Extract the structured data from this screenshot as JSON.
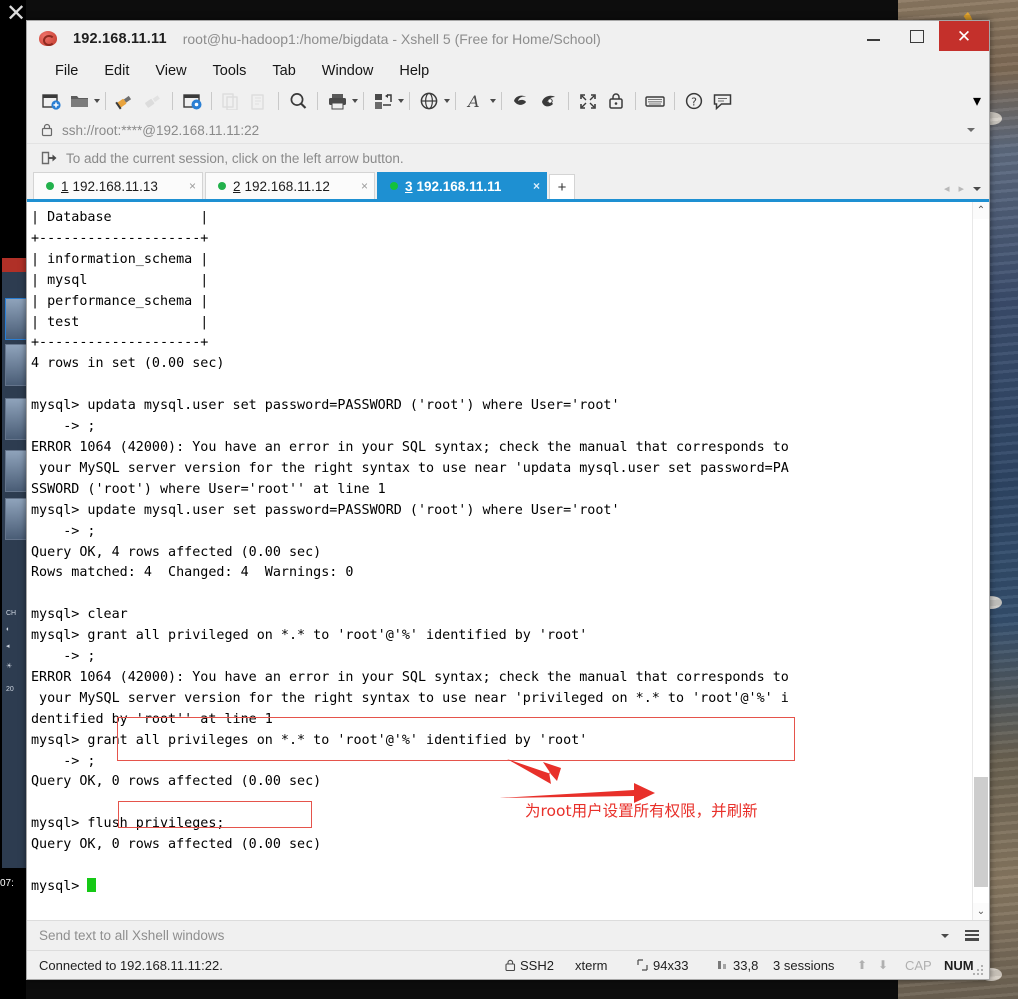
{
  "window": {
    "title_ip": "192.168.11.11",
    "title_rest": "root@hu-hadoop1:/home/bigdata - Xshell 5 (Free for Home/School)",
    "app_icon": "xshell-logo-icon",
    "minimize_label": "–",
    "maximize_label": "□",
    "close_label": "✕"
  },
  "menu": {
    "items": [
      {
        "label": "File"
      },
      {
        "label": "Edit"
      },
      {
        "label": "View"
      },
      {
        "label": "Tools"
      },
      {
        "label": "Tab"
      },
      {
        "label": "Window"
      },
      {
        "label": "Help"
      }
    ]
  },
  "toolbar": {
    "icons": [
      {
        "name": "new-session-icon"
      },
      {
        "name": "open-folder-icon"
      },
      {
        "name": "connect-plug-icon"
      },
      {
        "name": "disconnect-plug-icon"
      },
      {
        "name": "session-properties-icon"
      },
      {
        "name": "copy-icon"
      },
      {
        "name": "paste-icon"
      },
      {
        "name": "find-icon"
      },
      {
        "name": "print-icon"
      },
      {
        "name": "transfer-icon"
      },
      {
        "name": "globe-icon"
      },
      {
        "name": "font-icon"
      },
      {
        "name": "xftp-icon"
      },
      {
        "name": "xagent-icon"
      },
      {
        "name": "fullscreen-icon"
      },
      {
        "name": "lock-icon"
      },
      {
        "name": "keyboard-icon"
      },
      {
        "name": "help-icon"
      },
      {
        "name": "feedback-icon"
      }
    ],
    "overflow_label": "▾"
  },
  "address_bar": {
    "lock_icon": "lock-icon",
    "url": "ssh://root:****@192.168.11.11:22"
  },
  "hint_bar": {
    "icon": "add-session-icon",
    "text": "To add the current session, click on the left arrow button."
  },
  "tabs": {
    "items": [
      {
        "num": "1",
        "label": "192.168.11.13",
        "active": false,
        "close": "×"
      },
      {
        "num": "2",
        "label": "192.168.11.12",
        "active": false,
        "close": "×"
      },
      {
        "num": "3",
        "label": "192.168.11.11",
        "active": true,
        "close": "×"
      }
    ],
    "new_tab_label": "+",
    "nav_prev": "◂",
    "nav_next": "▸"
  },
  "terminal": {
    "lines": [
      "| Database           |",
      "+--------------------+",
      "| information_schema |",
      "| mysql              |",
      "| performance_schema |",
      "| test               |",
      "+--------------------+",
      "4 rows in set (0.00 sec)",
      "",
      "mysql> updata mysql.user set password=PASSWORD ('root') where User='root'",
      "    -> ;",
      "ERROR 1064 (42000): You have an error in your SQL syntax; check the manual that corresponds to",
      " your MySQL server version for the right syntax to use near 'updata mysql.user set password=PA",
      "SSWORD ('root') where User='root'' at line 1",
      "mysql> update mysql.user set password=PASSWORD ('root') where User='root'",
      "    -> ;",
      "Query OK, 4 rows affected (0.00 sec)",
      "Rows matched: 4  Changed: 4  Warnings: 0",
      "",
      "mysql> clear",
      "mysql> grant all privileged on *.* to 'root'@'%' identified by 'root'",
      "    -> ;",
      "ERROR 1064 (42000): You have an error in your SQL syntax; check the manual that corresponds to",
      " your MySQL server version for the right syntax to use near 'privileged on *.* to 'root'@'%' i",
      "dentified by 'root'' at line 1",
      "mysql> grant all privileges on *.* to 'root'@'%' identified by 'root'",
      "    -> ;",
      "Query OK, 0 rows affected (0.00 sec)",
      "",
      "mysql> flush privileges;",
      "Query OK, 0 rows affected (0.00 sec)",
      "",
      "mysql> "
    ],
    "cursor": "block-cursor"
  },
  "annotations": {
    "note_text": "为root用户设置所有权限，并刷新",
    "accent_color": "#e8302a"
  },
  "scrollbar": {
    "up_arrow": "⌃",
    "down_arrow": "⌄"
  },
  "send_bar": {
    "placeholder": "Send text to all Xshell windows"
  },
  "status_bar": {
    "connection": "Connected to 192.168.11.11:22.",
    "protocol": "SSH2",
    "terminal_type": "xterm",
    "size": "94x33",
    "cursor_pos": "33,8",
    "sessions": "3 sessions",
    "cap": "CAP",
    "num": "NUM",
    "lock_icon": "lock-icon",
    "resize_icon": "resize-grip-icon",
    "size_icon": "terminal-size-icon",
    "pos_icon": "cursor-position-icon",
    "up_arrow": "⬆",
    "down_arrow": "⬇"
  }
}
